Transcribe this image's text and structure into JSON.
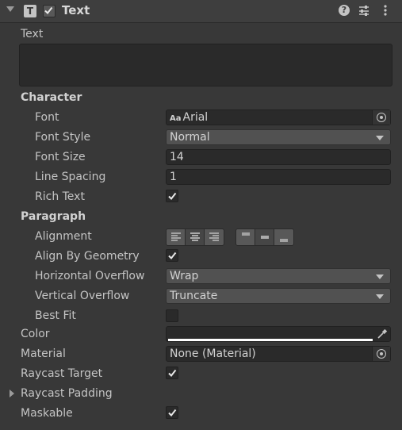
{
  "header": {
    "title": "Text",
    "component_icon_letter": "T",
    "enabled": true,
    "help_glyph": "?"
  },
  "text_section": {
    "label": "Text",
    "value": ""
  },
  "character": {
    "heading": "Character",
    "font_label": "Font",
    "font_icon": "Aa",
    "font_value": "Arial",
    "font_style_label": "Font Style",
    "font_style_value": "Normal",
    "font_size_label": "Font Size",
    "font_size_value": "14",
    "line_spacing_label": "Line Spacing",
    "line_spacing_value": "1",
    "rich_text_label": "Rich Text",
    "rich_text": true
  },
  "paragraph": {
    "heading": "Paragraph",
    "alignment_label": "Alignment",
    "horizontal_alignment_selected": "center",
    "vertical_alignment_selected": "middle",
    "align_by_geometry_label": "Align By Geometry",
    "align_by_geometry": true,
    "horizontal_overflow_label": "Horizontal Overflow",
    "horizontal_overflow_value": "Wrap",
    "vertical_overflow_label": "Vertical Overflow",
    "vertical_overflow_value": "Truncate",
    "best_fit_label": "Best Fit",
    "best_fit": false
  },
  "color": {
    "label": "Color",
    "value": "#ffffff"
  },
  "material": {
    "label": "Material",
    "value": "None (Material)"
  },
  "raycast_target": {
    "label": "Raycast Target",
    "checked": true
  },
  "raycast_padding": {
    "label": "Raycast Padding",
    "expanded": false
  },
  "maskable": {
    "label": "Maskable",
    "checked": true
  }
}
